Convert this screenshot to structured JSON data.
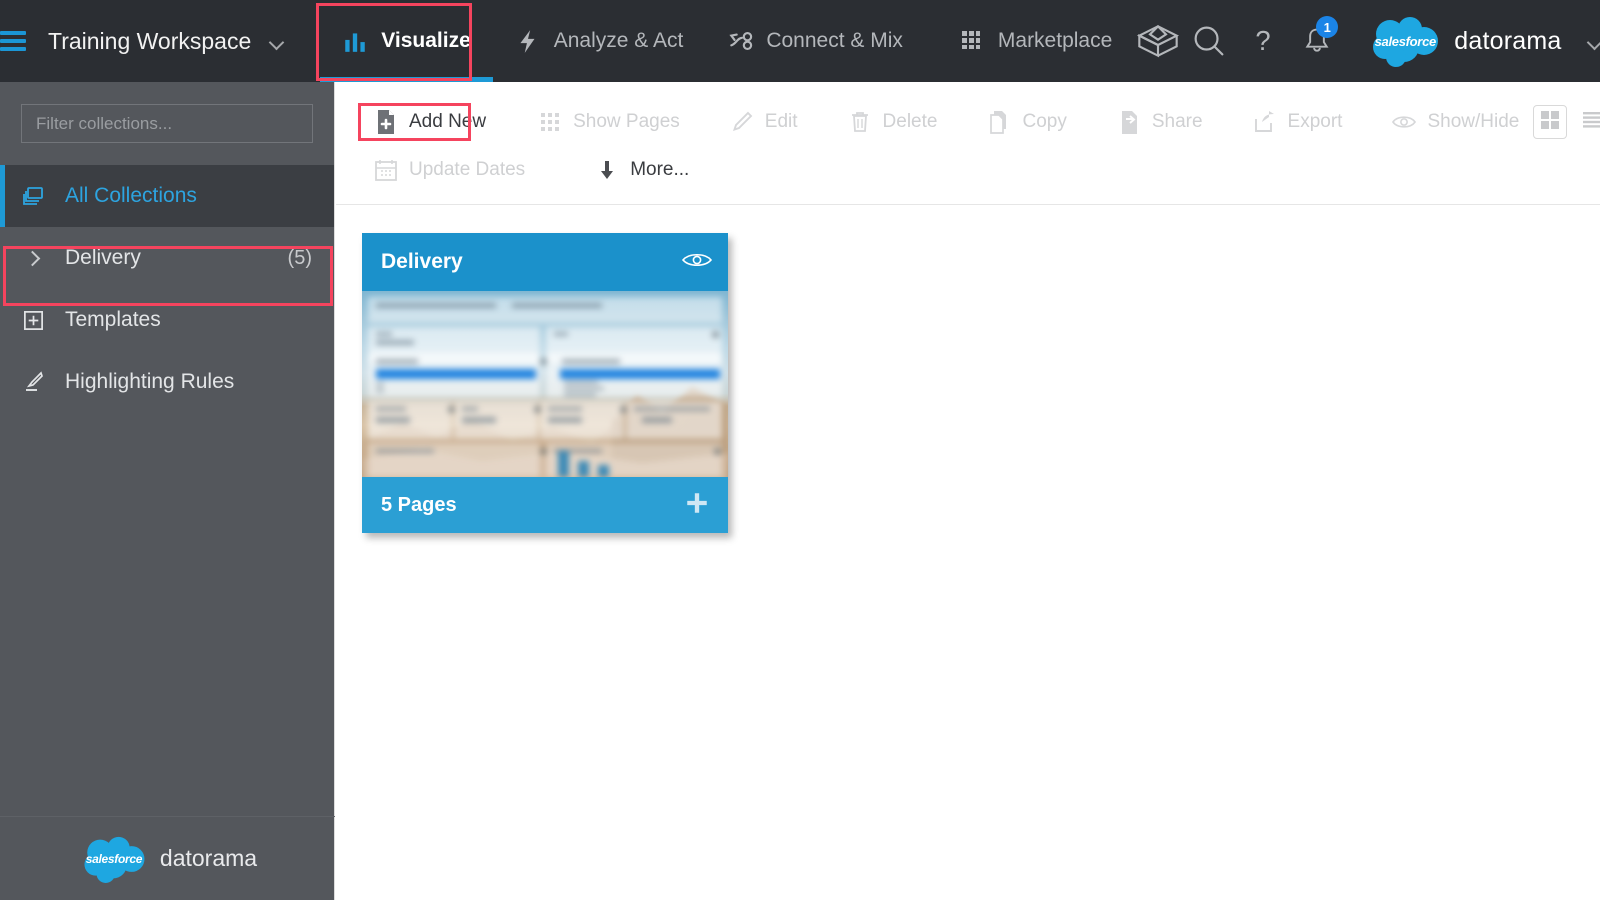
{
  "topnav": {
    "hamburger_name": "menu-icon",
    "workspace": {
      "label": "Training Workspace"
    },
    "items": [
      {
        "label": "Visualize",
        "icon": "bar-chart-icon",
        "active": true
      },
      {
        "label": "Analyze & Act",
        "icon": "lightning-bolt-icon",
        "active": false
      },
      {
        "label": "Connect & Mix",
        "icon": "connector-icon",
        "active": false
      },
      {
        "label": "Marketplace",
        "icon": "grid-apps-icon",
        "active": false
      }
    ],
    "right_icons": [
      "cube-icon",
      "search-icon",
      "help-icon",
      "bell-icon"
    ],
    "notification_count": "1",
    "brand": {
      "cloud_text": "salesforce",
      "name": "datorama"
    },
    "accent_blue": "#1e9ad6",
    "highlight_red": "#f5445e"
  },
  "sidebar": {
    "filter": {
      "placeholder": "Filter collections...",
      "value": ""
    },
    "items": [
      {
        "label": "All Collections",
        "icon": "collections-icon",
        "count": "",
        "selected": true,
        "expandable": false
      },
      {
        "label": "Delivery",
        "icon": "",
        "count": "(5)",
        "selected": false,
        "expandable": true
      },
      {
        "label": "Templates",
        "icon": "plus-square-icon",
        "count": "",
        "selected": false,
        "expandable": false
      },
      {
        "label": "Highlighting Rules",
        "icon": "highlighter-icon",
        "count": "",
        "selected": false,
        "expandable": false
      }
    ],
    "footer": {
      "cloud_text": "salesforce",
      "name": "datorama"
    }
  },
  "toolbar": {
    "row1": [
      {
        "label": "Add New",
        "icon": "file-add-icon",
        "enabled": true,
        "highlighted": true
      },
      {
        "label": "Show Pages",
        "icon": "grid-pages-icon",
        "enabled": false,
        "highlighted": false
      },
      {
        "label": "Edit",
        "icon": "pencil-icon",
        "enabled": false,
        "highlighted": false
      },
      {
        "label": "Delete",
        "icon": "trash-icon",
        "enabled": false,
        "highlighted": false
      },
      {
        "label": "Copy",
        "icon": "copy-icon",
        "enabled": false,
        "highlighted": false
      },
      {
        "label": "Share",
        "icon": "share-file-icon",
        "enabled": false,
        "highlighted": false
      },
      {
        "label": "Export",
        "icon": "export-icon",
        "enabled": false,
        "highlighted": false
      },
      {
        "label": "Show/Hide",
        "icon": "eye-icon",
        "enabled": false,
        "highlighted": false
      }
    ],
    "row2": [
      {
        "label": "Update Dates",
        "icon": "calendar-icon",
        "enabled": false,
        "highlighted": false
      },
      {
        "label": "More...",
        "icon": "arrow-down-icon",
        "enabled": true,
        "highlighted": false
      }
    ],
    "view_toggle": [
      {
        "name": "grid-view-button",
        "icon": "grid-view-icon",
        "active": true
      },
      {
        "name": "list-view-button",
        "icon": "list-view-icon",
        "active": false
      }
    ]
  },
  "content": {
    "cards": [
      {
        "title": "Delivery",
        "pages_label": "5 Pages",
        "header_icon": "eye-icon",
        "add_icon": "plus-icon",
        "thumbnail": "dashboard-preview-thumbnail",
        "header_color": "#1b91cb",
        "footer_color": "#2b9fd4"
      }
    ]
  }
}
